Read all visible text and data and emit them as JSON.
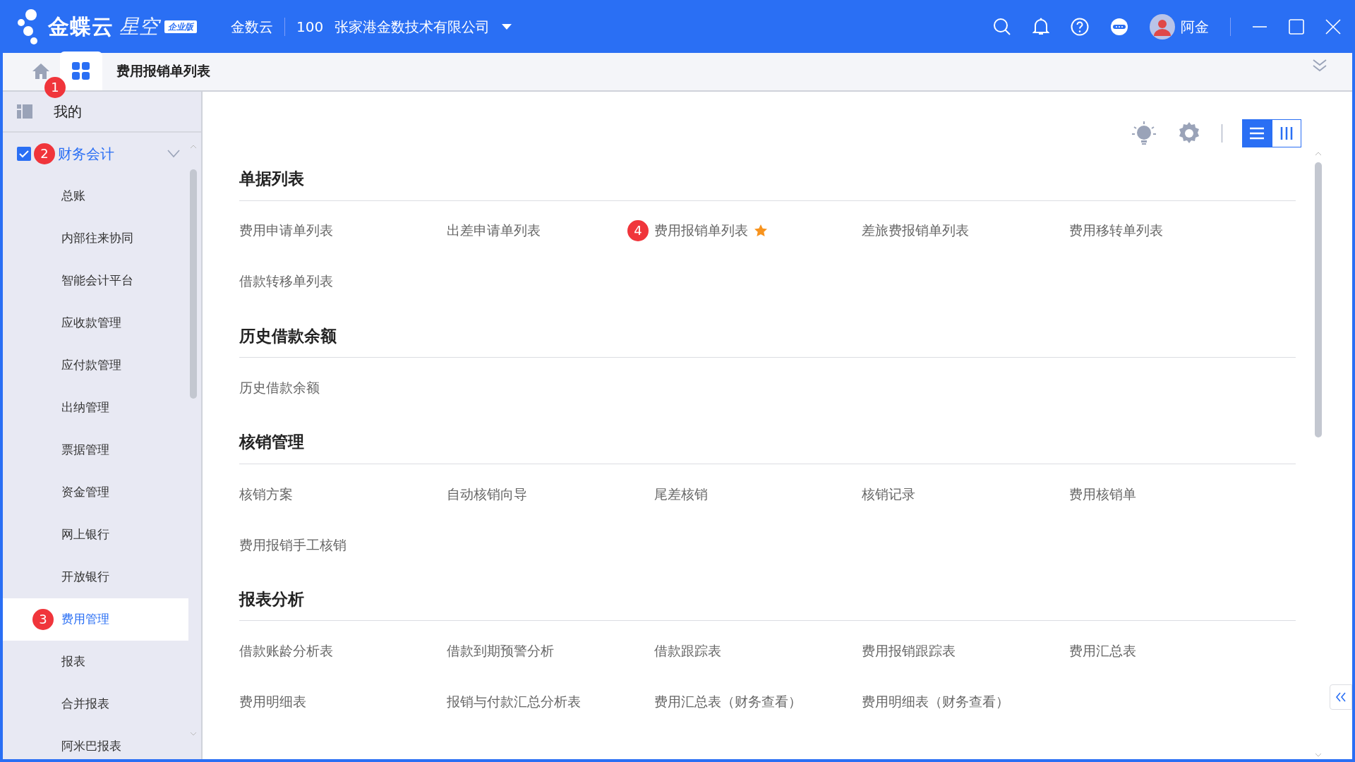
{
  "header": {
    "logo_main": "金蝶云",
    "logo_sub": "星空",
    "edition": "企业版",
    "org_short": "金数云",
    "org_code": "100",
    "org_name": "张家港金数技术有限公司",
    "user": "阿金"
  },
  "tabbar": {
    "apps_badge": "1",
    "tabs": [
      {
        "label": "费用报销单列表",
        "selected": true
      }
    ]
  },
  "sidebar": {
    "mine": "我的",
    "group": {
      "label": "财务会计",
      "badge": "2",
      "checked": true,
      "expanded": true
    },
    "items": [
      {
        "label": "总账",
        "selected": false
      },
      {
        "label": "内部往来协同",
        "selected": false
      },
      {
        "label": "智能会计平台",
        "selected": false
      },
      {
        "label": "应收款管理",
        "selected": false
      },
      {
        "label": "应付款管理",
        "selected": false
      },
      {
        "label": "出纳管理",
        "selected": false
      },
      {
        "label": "票据管理",
        "selected": false
      },
      {
        "label": "资金管理",
        "selected": false
      },
      {
        "label": "网上银行",
        "selected": false
      },
      {
        "label": "开放银行",
        "selected": false
      },
      {
        "label": "费用管理",
        "selected": true,
        "badge": "3"
      },
      {
        "label": "报表",
        "selected": false
      },
      {
        "label": "合并报表",
        "selected": false
      },
      {
        "label": "阿米巴报表",
        "selected": false
      }
    ]
  },
  "view_modes": [
    {
      "kind": "list",
      "selected": true
    },
    {
      "kind": "columns",
      "selected": false
    }
  ],
  "sections": [
    {
      "title": "单据列表",
      "items": [
        {
          "label": "费用申请单列表",
          "starred": false
        },
        {
          "label": "出差申请单列表",
          "starred": false
        },
        {
          "label": "费用报销单列表",
          "badge": "4",
          "starred": true
        },
        {
          "label": "差旅费报销单列表",
          "starred": false
        },
        {
          "label": "费用移转单列表",
          "starred": false
        },
        {
          "label": "借款转移单列表",
          "starred": false
        }
      ]
    },
    {
      "title": "历史借款余额",
      "items": [
        {
          "label": "历史借款余额",
          "starred": false
        }
      ]
    },
    {
      "title": "核销管理",
      "items": [
        {
          "label": "核销方案",
          "starred": false
        },
        {
          "label": "自动核销向导",
          "starred": false
        },
        {
          "label": "尾差核销",
          "starred": false
        },
        {
          "label": "核销记录",
          "starred": false
        },
        {
          "label": "费用核销单",
          "starred": false
        },
        {
          "label": "费用报销手工核销",
          "starred": false
        }
      ]
    },
    {
      "title": "报表分析",
      "items": [
        {
          "label": "借款账龄分析表",
          "starred": false
        },
        {
          "label": "借款到期预警分析",
          "starred": false
        },
        {
          "label": "借款跟踪表",
          "starred": false
        },
        {
          "label": "费用报销跟踪表",
          "starred": false
        },
        {
          "label": "费用汇总表",
          "starred": false
        },
        {
          "label": "费用明细表",
          "starred": false
        },
        {
          "label": "报销与付款汇总分析表",
          "starred": false
        },
        {
          "label": "费用汇总表（财务查看）",
          "starred": false
        },
        {
          "label": "费用明细表（财务查看）",
          "starred": false
        }
      ]
    }
  ]
}
